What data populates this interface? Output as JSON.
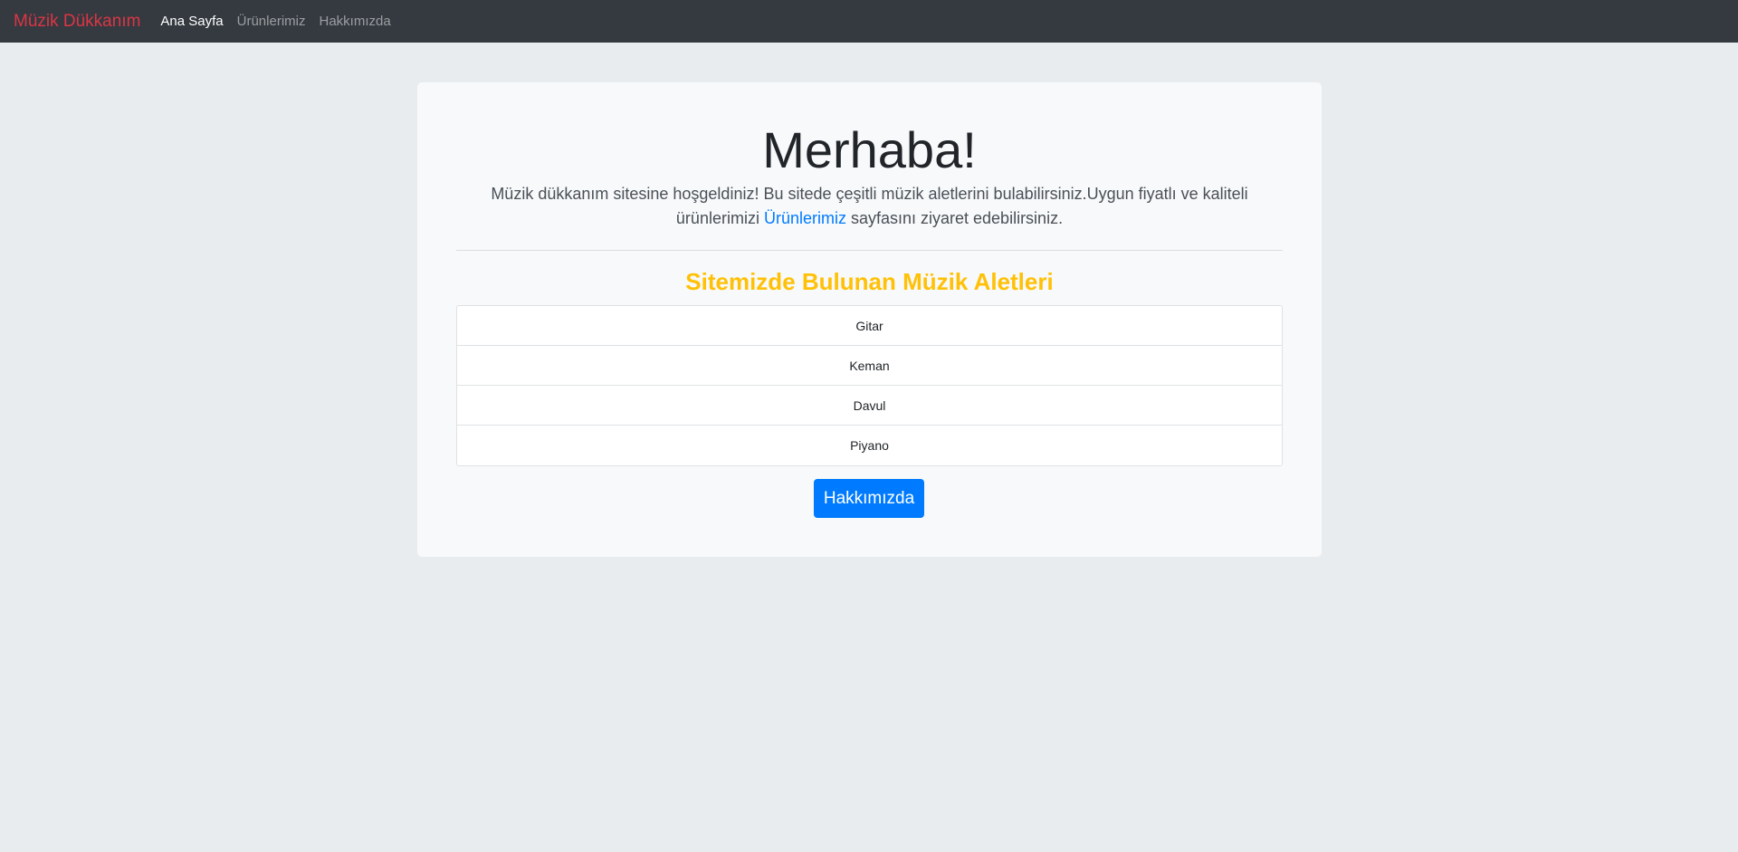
{
  "navbar": {
    "brand": "Müzik Dükkanım",
    "links": [
      {
        "label": "Ana Sayfa",
        "active": true
      },
      {
        "label": "Ürünlerimiz",
        "active": false
      },
      {
        "label": "Hakkımızda",
        "active": false
      }
    ]
  },
  "hero": {
    "title": "Merhaba!",
    "lead_before": "Müzik dükkanım sitesine hoşgeldiniz! Bu sitede çeşitli müzik aletlerini bulabilirsiniz.Uygun fiyatlı ve kaliteli ürünlerimizi ",
    "lead_link": "Ürünlerimiz",
    "lead_after": " sayfasını ziyaret edebilirsiniz."
  },
  "instruments": {
    "title": "Sitemizde Bulunan Müzik Aletleri",
    "items": [
      "Gitar",
      "Keman",
      "Davul",
      "Piyano"
    ]
  },
  "about_button": {
    "label": "Hakkımızda"
  },
  "colors": {
    "navbar_bg": "#343a40",
    "brand": "#dc3545",
    "section_title": "#ffc107",
    "primary": "#007bff",
    "page_bg": "#e9ecef"
  }
}
